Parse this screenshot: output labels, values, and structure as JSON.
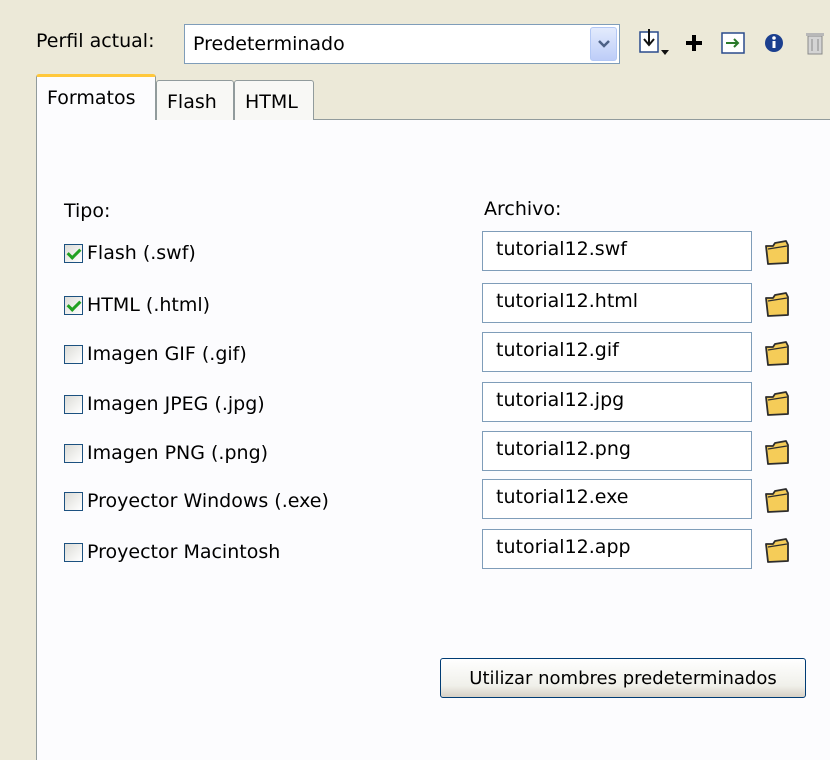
{
  "profile": {
    "label": "Perfil actual:",
    "value": "Predeterminado"
  },
  "toolbar": {
    "icons": [
      "import-export-icon",
      "add-icon",
      "duplicate-icon",
      "properties-icon",
      "delete-icon"
    ]
  },
  "tabs": [
    {
      "label": "Formatos",
      "selected": true
    },
    {
      "label": "Flash",
      "selected": false
    },
    {
      "label": "HTML",
      "selected": false
    }
  ],
  "formats": {
    "type_header": "Tipo:",
    "file_header": "Archivo:",
    "rows": [
      {
        "label": "Flash  (.swf)",
        "checked": true,
        "file": "tutorial12.swf"
      },
      {
        "label": "HTML (.html)",
        "checked": true,
        "file": "tutorial12.html"
      },
      {
        "label": "Imagen GIF (.gif)",
        "checked": false,
        "file": "tutorial12.gif"
      },
      {
        "label": "Imagen JPEG (.jpg)",
        "checked": false,
        "file": "tutorial12.jpg"
      },
      {
        "label": "Imagen PNG (.png)",
        "checked": false,
        "file": "tutorial12.png"
      },
      {
        "label": "Proyector Windows (.exe)",
        "checked": false,
        "file": "tutorial12.exe"
      },
      {
        "label": "Proyector Macintosh",
        "checked": false,
        "file": "tutorial12.app"
      }
    ],
    "default_names_button": "Utilizar nombres predeterminados"
  },
  "colors": {
    "background": "#ece9d8",
    "panel": "#fcfcfe",
    "active_tab_accent": "#ffc83c",
    "check_mark": "#21a121",
    "folder": "#f5cc58"
  }
}
